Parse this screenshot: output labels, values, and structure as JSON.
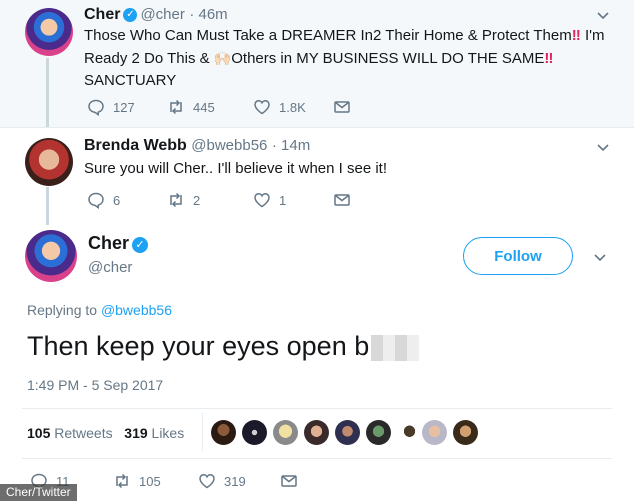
{
  "tweet1": {
    "name": "Cher",
    "handle": "@cher",
    "time": "· 46m",
    "text_line1_a": "Those Who Can Must Take a DREAMER In2 Their Home & Protect Them",
    "text_line1_b": "I'm",
    "text_line2_a": "Ready 2 Do This &",
    "text_line2_b": "Others in MY BUSINESS WILL DO THE SAME",
    "text_line3": "SANCTUARY",
    "emphasis": "‼",
    "stats": {
      "replies": "127",
      "retweets": "445",
      "likes": "1.8K"
    }
  },
  "tweet2": {
    "name": "Brenda Webb",
    "handle": "@bwebb56",
    "time": "· 14m",
    "text": "Sure you will Cher.. I'll believe it when I see it!",
    "stats": {
      "replies": "6",
      "retweets": "2",
      "likes": "1"
    }
  },
  "tweet3": {
    "name": "Cher",
    "handle": "@cher",
    "follow_label": "Follow",
    "replying_prefix": "Replying to",
    "replying_handle": "@bwebb56",
    "text": "Then keep your eyes open b",
    "timestamp": "1:49 PM - 5 Sep 2017",
    "retweet_count": "105",
    "retweet_label": "Retweets",
    "like_count": "319",
    "like_label": "Likes",
    "stats": {
      "replies": "11",
      "retweets": "105",
      "likes": "319"
    }
  },
  "watermark": "Cher/Twitter",
  "colors": {
    "accent": "#1da1f2",
    "muted": "#657786",
    "line": "#ccd6dd",
    "bg_highlight": "#f5f8fa"
  }
}
